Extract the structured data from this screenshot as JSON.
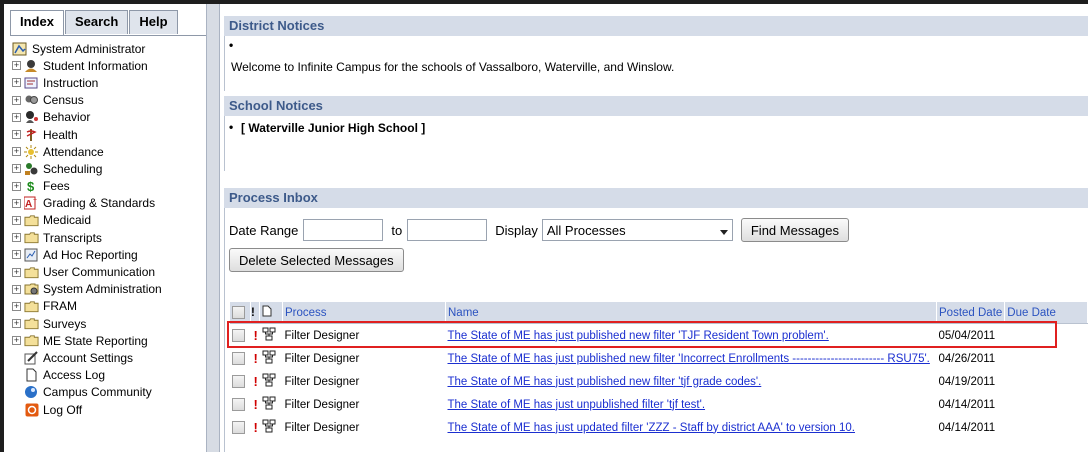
{
  "nav": {
    "tabs": [
      {
        "label": "Index"
      },
      {
        "label": "Search"
      },
      {
        "label": "Help"
      }
    ],
    "root_label": "System Administrator",
    "items": [
      {
        "label": "Student Information",
        "icon": "student-icon",
        "expandable": true
      },
      {
        "label": "Instruction",
        "icon": "instruction-icon",
        "expandable": true
      },
      {
        "label": "Census",
        "icon": "census-icon",
        "expandable": true
      },
      {
        "label": "Behavior",
        "icon": "behavior-icon",
        "expandable": true
      },
      {
        "label": "Health",
        "icon": "health-icon",
        "expandable": true
      },
      {
        "label": "Attendance",
        "icon": "attendance-icon",
        "expandable": true
      },
      {
        "label": "Scheduling",
        "icon": "scheduling-icon",
        "expandable": true
      },
      {
        "label": "Fees",
        "icon": "fees-icon",
        "expandable": true
      },
      {
        "label": "Grading & Standards",
        "icon": "grading-icon",
        "expandable": true
      },
      {
        "label": "Medicaid",
        "icon": "folder-icon",
        "expandable": true
      },
      {
        "label": "Transcripts",
        "icon": "folder-icon",
        "expandable": true
      },
      {
        "label": "Ad Hoc Reporting",
        "icon": "adhoc-icon",
        "expandable": true
      },
      {
        "label": "User Communication",
        "icon": "folder-icon",
        "expandable": true
      },
      {
        "label": "System Administration",
        "icon": "sysadmin-icon",
        "expandable": true
      },
      {
        "label": "FRAM",
        "icon": "folder-icon",
        "expandable": true
      },
      {
        "label": "Surveys",
        "icon": "folder-icon",
        "expandable": true
      },
      {
        "label": "ME State Reporting",
        "icon": "folder-icon",
        "expandable": true
      },
      {
        "label": "Account Settings",
        "icon": "account-settings-icon",
        "expandable": false
      },
      {
        "label": "Access Log",
        "icon": "document-icon",
        "expandable": false
      },
      {
        "label": "Campus Community",
        "icon": "community-icon",
        "expandable": false
      },
      {
        "label": "Log Off",
        "icon": "logoff-icon",
        "expandable": false
      }
    ]
  },
  "district": {
    "title": "District Notices",
    "bullet": "•",
    "message": "Welcome to Infinite Campus for the schools of Vassalboro, Waterville, and Winslow."
  },
  "school": {
    "title": "School Notices",
    "bullet": "•",
    "message": "[ Waterville Junior High School ]"
  },
  "inbox": {
    "title": "Process Inbox",
    "date_range_label": "Date Range",
    "to_label": "to",
    "display_label": "Display",
    "display_value": "All Processes",
    "find_button": "Find Messages",
    "delete_button": "Delete Selected Messages",
    "columns": {
      "process": "Process",
      "name": "Name",
      "posted": "Posted Date",
      "due": "Due Date"
    },
    "rows": [
      {
        "process": "Filter Designer",
        "name": "The State of ME has just published new filter 'TJF Resident Town problem'.",
        "posted": "05/04/2011",
        "due": ""
      },
      {
        "process": "Filter Designer",
        "name": "The State of ME has just published new filter 'Incorrect Enrollments ------------------------ RSU75'.",
        "posted": "04/26/2011",
        "due": ""
      },
      {
        "process": "Filter Designer",
        "name": "The State of ME has just published new filter 'tjf grade codes'.",
        "posted": "04/19/2011",
        "due": ""
      },
      {
        "process": "Filter Designer",
        "name": "The State of ME has just unpublished filter 'tjf test'.",
        "posted": "04/14/2011",
        "due": ""
      },
      {
        "process": "Filter Designer",
        "name": "The State of ME has just updated filter 'ZZZ - Staff by district AAA' to version 10.",
        "posted": "04/14/2011",
        "due": ""
      }
    ]
  },
  "colors": {
    "panel_header_bg": "#d5dce8",
    "panel_header_text": "#3d5a8a",
    "link": "#1b2fd0",
    "highlight": "#e02020",
    "priority": "#d00000"
  }
}
